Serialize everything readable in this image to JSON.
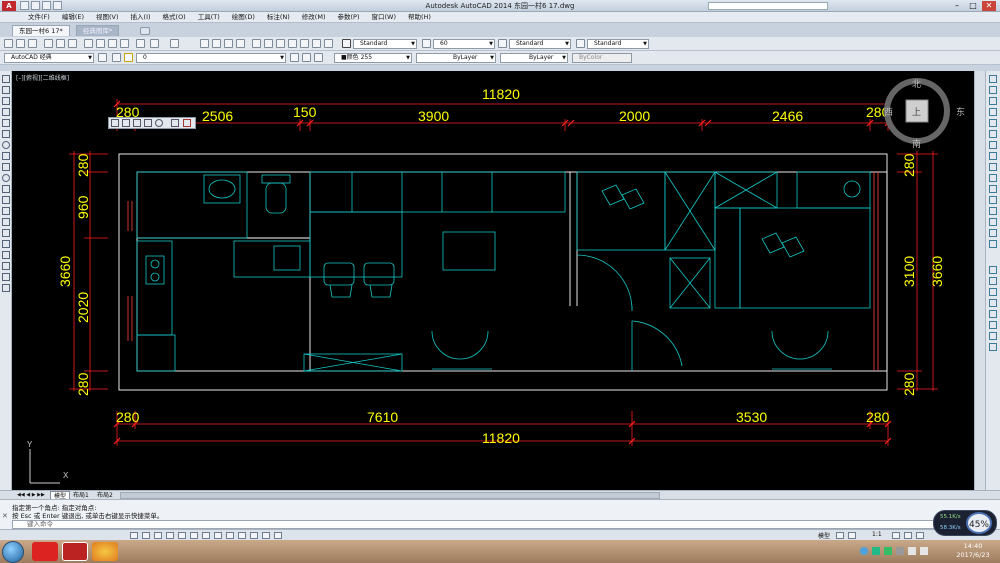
{
  "window": {
    "app_logo": "A",
    "title": "Autodesk AutoCAD 2014   东园一村6 17.dwg",
    "search_placeholder": "",
    "min": "–",
    "max": "□",
    "close": "✕"
  },
  "menu": [
    "文件(F)",
    "编辑(E)",
    "视图(V)",
    "插入(I)",
    "格式(O)",
    "工具(T)",
    "绘图(D)",
    "标注(N)",
    "修改(M)",
    "参数(P)",
    "窗口(W)",
    "帮助(H)"
  ],
  "file_tabs": [
    "东园一村6 17*",
    "经典图库*"
  ],
  "toolbar": {
    "text_style": "Standard",
    "dim_scale": "60",
    "dim_style": "Standard",
    "table_style": "Standard",
    "workspace": "AutoCAD 经典",
    "layer": "0",
    "color": "■颜色 255",
    "linetype": "ByLayer",
    "lineweight": "ByLayer",
    "plotstyle": "ByColor"
  },
  "viewport_label": "[–][俯视][二维线框]",
  "viewcube": {
    "north": "北",
    "south": "南",
    "east": "东",
    "west": "西",
    "top": "上"
  },
  "dimensions": {
    "top_total": "11820",
    "top_segments": [
      "280",
      "2506",
      "150",
      "3900",
      "2000",
      "2466",
      "280"
    ],
    "bottom_segments": [
      "280",
      "7610",
      "3530",
      "280"
    ],
    "bottom_total": "11820",
    "left_outer": "3660",
    "left_inner": [
      "280",
      "960",
      "2020",
      "280"
    ],
    "right_inner": [
      "280",
      "3100",
      "280"
    ],
    "right_outer": "3660"
  },
  "layout_tabs": [
    "模型",
    "布局1",
    "布局2"
  ],
  "command": {
    "line1": "指定第一个角点: 指定对角点:",
    "line2": "按 Esc 或 Enter 键退出, 或单击右键显示快捷菜单。",
    "prompt": "键入命令"
  },
  "status": {
    "model": "模型",
    "scale": "1:1"
  },
  "network": {
    "up": "55.1K/s",
    "down": "58.3K/s",
    "percent": "45%"
  },
  "clock": {
    "time": "14:40",
    "date": "2017/6/23"
  },
  "colors": {
    "dim_text": "#ffff00",
    "dim_line": "#ff0000",
    "wall": "#ffffff",
    "furniture": "#00c8c8",
    "background": "#000000"
  }
}
